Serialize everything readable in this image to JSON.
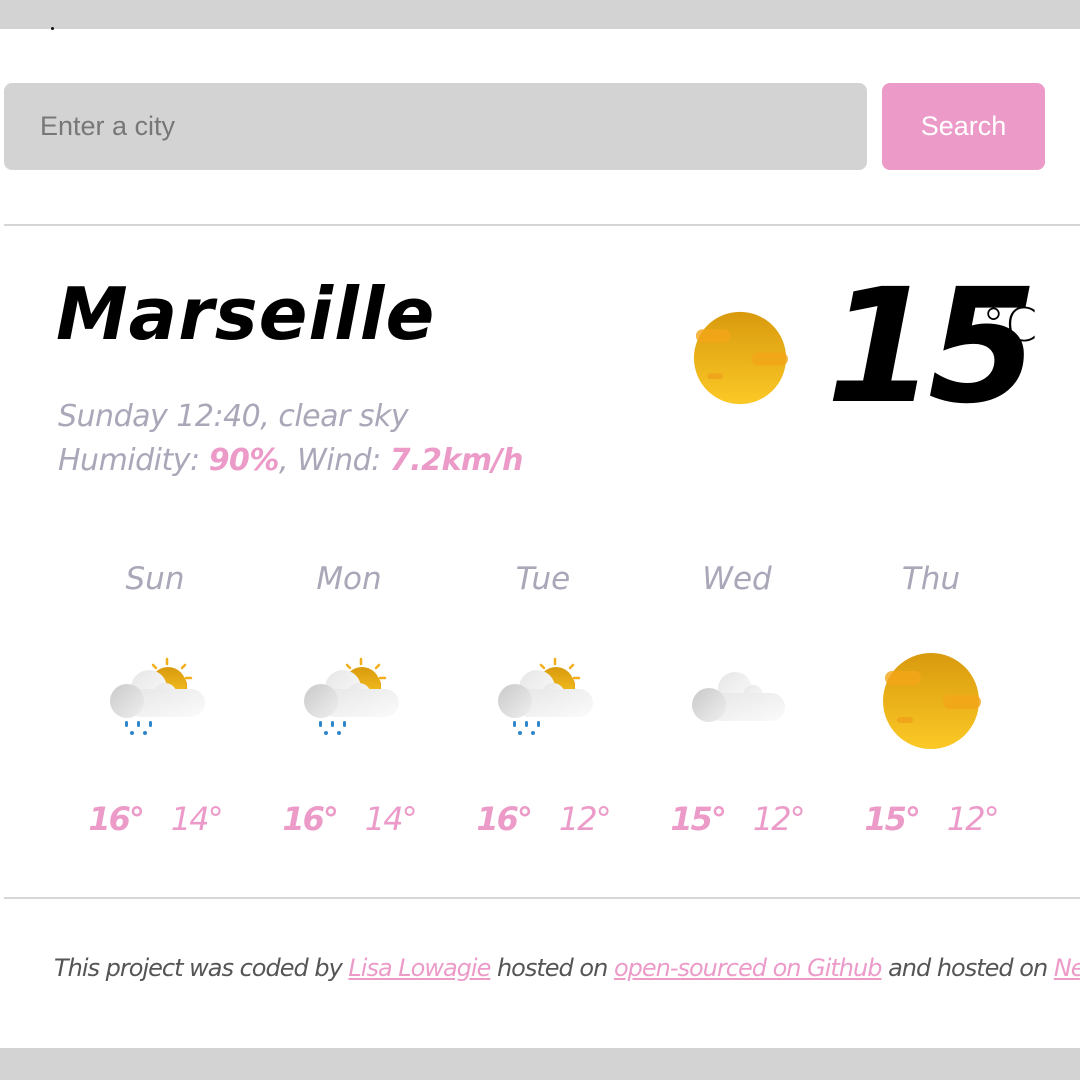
{
  "search": {
    "placeholder": "Enter a city",
    "value": "",
    "button_label": "Search"
  },
  "current": {
    "city": "Marseille",
    "day_time": "Sunday 12:40",
    "description": "clear sky",
    "humidity_label": "Humidity:",
    "humidity_value": "90%",
    "wind_label": "Wind:",
    "wind_value": "7.2km/h",
    "temperature": "15",
    "unit": "°C",
    "icon": "clear-sky-sun-icon"
  },
  "forecast": [
    {
      "day": "Sun",
      "icon": "rain-sun-cloud-icon",
      "max": "16°",
      "min": "14°"
    },
    {
      "day": "Mon",
      "icon": "rain-sun-cloud-icon",
      "max": "16°",
      "min": "14°"
    },
    {
      "day": "Tue",
      "icon": "rain-sun-cloud-icon",
      "max": "16°",
      "min": "12°"
    },
    {
      "day": "Wed",
      "icon": "cloud-icon",
      "max": "15°",
      "min": "12°"
    },
    {
      "day": "Thu",
      "icon": "clear-sky-sun-icon",
      "max": "15°",
      "min": "12°"
    }
  ],
  "footer": {
    "text_1": "This project was coded by ",
    "author_link": "Lisa Lowagie",
    "text_2": " hosted on ",
    "github_link": "open-sourced on Github",
    "text_3": " and hosted on ",
    "netlify_link": "Netlify."
  },
  "colors": {
    "accent": "#ec9bc9",
    "muted_text": "#a9a7b8",
    "input_bg": "#d3d3d3",
    "sun": "#f0b414"
  }
}
